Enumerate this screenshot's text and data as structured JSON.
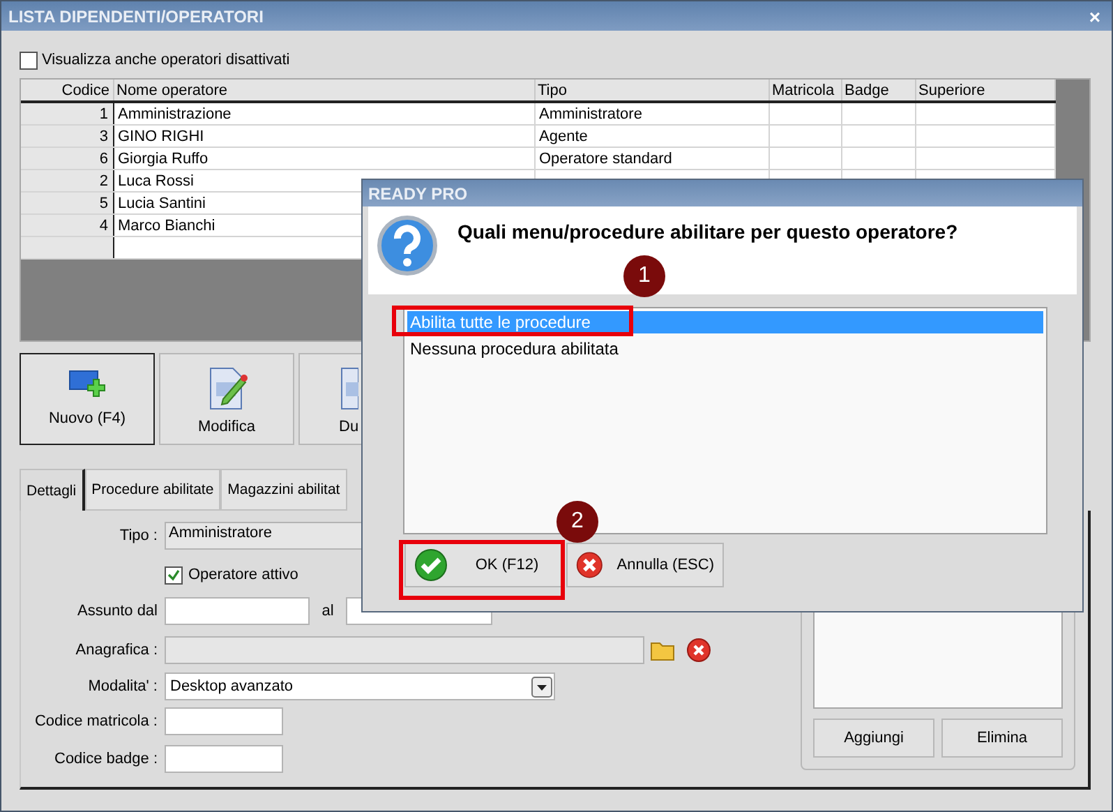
{
  "window": {
    "title": "LISTA DIPENDENTI/OPERATORI",
    "close": "×"
  },
  "show_disabled": {
    "label": "Visualizza anche operatori disattivati",
    "checked": false
  },
  "table": {
    "columns": [
      "Codice",
      "Nome operatore",
      "Tipo",
      "Matricola",
      "Badge",
      "Superiore"
    ],
    "rows": [
      {
        "code": "1",
        "name": "Amministrazione",
        "type": "Amministratore"
      },
      {
        "code": "3",
        "name": "GINO RIGHI",
        "type": "Agente"
      },
      {
        "code": "6",
        "name": "Giorgia Ruffo",
        "type": "Operatore standard"
      },
      {
        "code": "2",
        "name": "Luca Rossi"
      },
      {
        "code": "5",
        "name": "Lucia Santini"
      },
      {
        "code": "4",
        "name": "Marco Bianchi"
      }
    ]
  },
  "toolbar": [
    {
      "label": "Nuovo (F4)",
      "kind": "new",
      "selected": true
    },
    {
      "label": "Modifica",
      "kind": "edit",
      "selected": false
    },
    {
      "label": "Du",
      "kind": "copy",
      "selected": false
    }
  ],
  "tabs": [
    {
      "label": "Dettagli",
      "selected": true
    },
    {
      "label": "Procedure abilitate",
      "selected": false
    },
    {
      "label": "Magazzini abilitat",
      "selected": false
    }
  ],
  "form": {
    "tipo": {
      "label": "Tipo :",
      "value": "Amministratore"
    },
    "active": {
      "label": "Operatore attivo",
      "checked": true
    },
    "hired": {
      "label": "Assunto dal",
      "to_label": "al"
    },
    "anagrafica": {
      "label": "Anagrafica :"
    },
    "mode": {
      "label": "Modalita' :",
      "value": "Desktop avanzato"
    },
    "matricola": {
      "label": "Codice matricola :"
    },
    "badge": {
      "label": "Codice badge :"
    }
  },
  "side_panel": {
    "buttons": [
      "Aggiungi",
      "Elimina"
    ]
  },
  "dialog": {
    "title": "READY PRO",
    "question": "Quali menu/procedure abilitare per questo operatore?",
    "options": [
      {
        "label": "Abilita tutte le procedure",
        "selected": true
      },
      {
        "label": "Nessuna procedura abilitata",
        "selected": false
      }
    ],
    "buttons": [
      {
        "label": "OK (F12)",
        "kind": "ok"
      },
      {
        "label": "Annulla (ESC)",
        "kind": "cancel"
      }
    ]
  },
  "annotations": [
    {
      "label": "1"
    },
    {
      "label": "2"
    }
  ]
}
